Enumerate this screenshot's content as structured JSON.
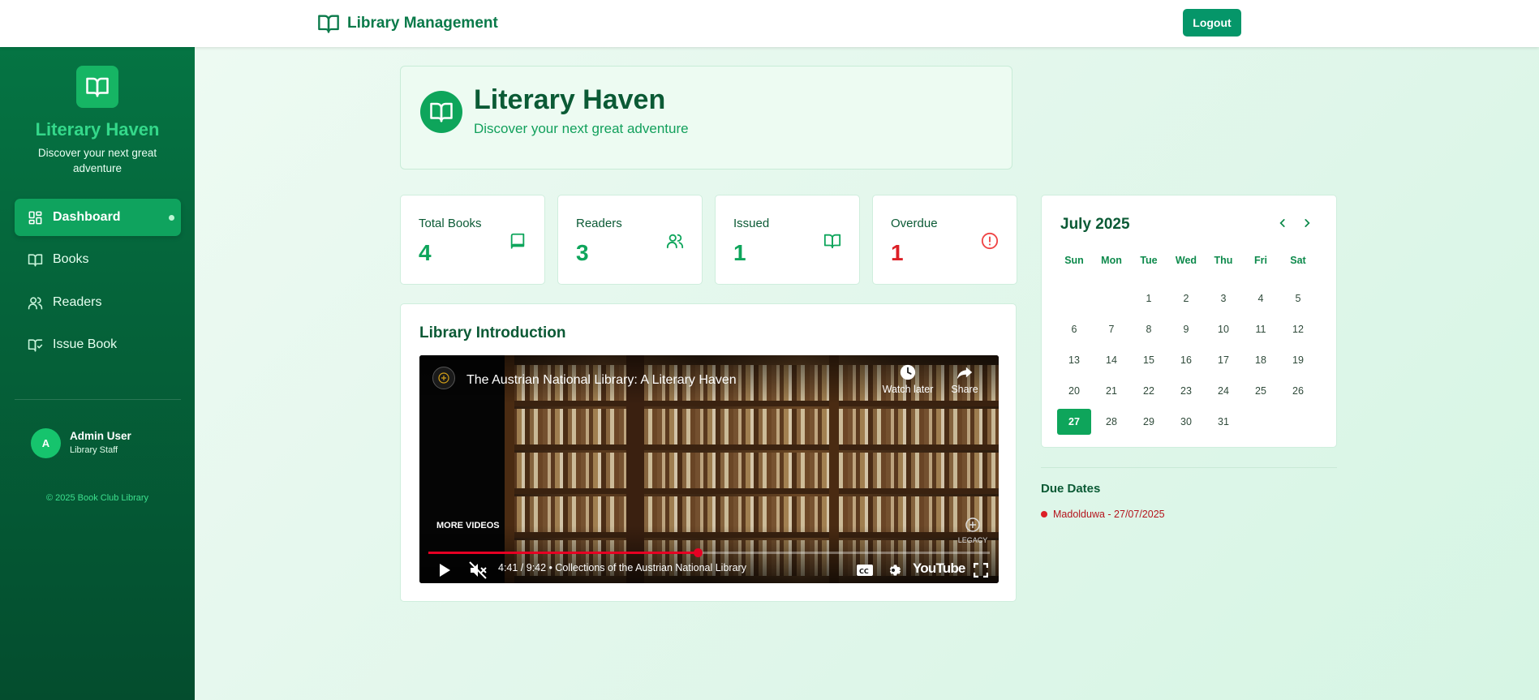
{
  "topbar": {
    "brand": "Library Management",
    "logout_label": "Logout"
  },
  "sidebar": {
    "title": "Literary Haven",
    "subtitle": "Discover your next great adventure",
    "items": [
      {
        "label": "Dashboard",
        "icon": "dashboard-grid-icon",
        "active": true
      },
      {
        "label": "Books",
        "icon": "open-book-icon"
      },
      {
        "label": "Readers",
        "icon": "users-icon"
      },
      {
        "label": "Issue Book",
        "icon": "book-check-icon"
      }
    ],
    "user": {
      "initial": "A",
      "name": "Admin User",
      "role": "Library Staff"
    },
    "footer": "© 2025 Book Club Library"
  },
  "header": {
    "title": "Literary Haven",
    "subtitle": "Discover your next great adventure"
  },
  "stats": [
    {
      "label": "Total Books",
      "value": "4",
      "icon": "book-icon",
      "color": "#0ea55b"
    },
    {
      "label": "Readers",
      "value": "3",
      "icon": "users-icon",
      "color": "#0ea55b"
    },
    {
      "label": "Issued",
      "value": "1",
      "icon": "open-book-icon",
      "color": "#0ea55b"
    },
    {
      "label": "Overdue",
      "value": "1",
      "icon": "alert-circle-icon",
      "color": "#dc1f26"
    }
  ],
  "intro": {
    "title": "Library Introduction",
    "video": {
      "title": "The Austrian National Library: A Literary Haven",
      "watch_later": "Watch later",
      "share": "Share",
      "more_videos": "MORE VIDEOS",
      "time": "4:41 / 9:42 • Collections of the Austrian National Library",
      "progress": 0.48,
      "brand": "YouTube",
      "channel_mark": "LEGACY"
    }
  },
  "calendar": {
    "month": "July 2025",
    "weekdays": [
      "Sun",
      "Mon",
      "Tue",
      "Wed",
      "Thu",
      "Fri",
      "Sat"
    ],
    "first_weekday_index": 2,
    "days_in_month": 31,
    "today": 27
  },
  "due": {
    "title": "Due Dates",
    "items": [
      {
        "text": "Madolduwa - 27/07/2025"
      }
    ]
  },
  "colors": {
    "accent": "#059669",
    "sidebar_start": "#057443",
    "danger": "#dc1f26"
  }
}
